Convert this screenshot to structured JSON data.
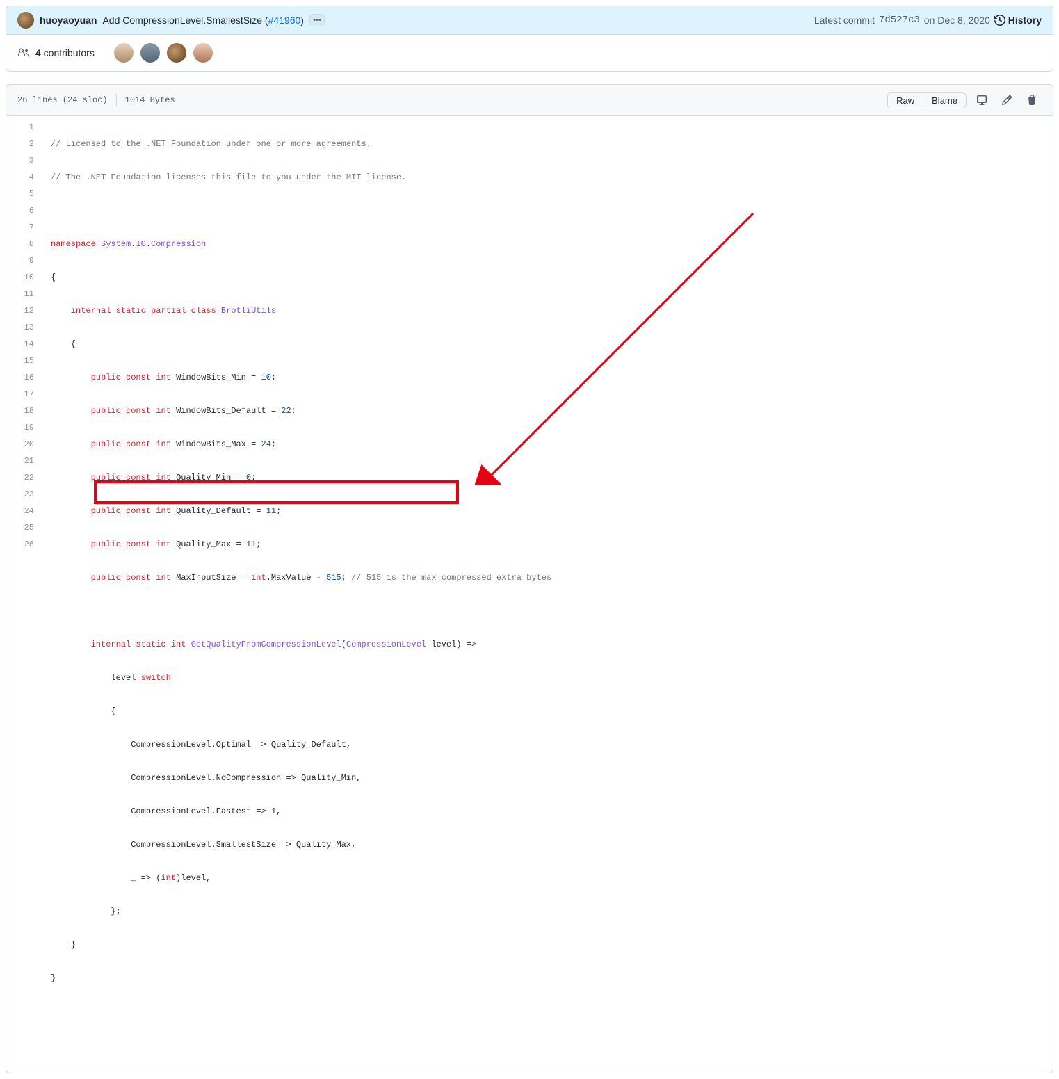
{
  "commit": {
    "author": "huoyaoyuan",
    "message_prefix": "Add CompressionLevel.SmallestSize (",
    "pr_text": "#41960",
    "message_suffix": ")",
    "latest_label": "Latest commit",
    "sha": "7d527c3",
    "date_prefix": "on ",
    "date": "Dec 8, 2020",
    "history_label": "History"
  },
  "contributors": {
    "count": "4",
    "label": " contributors"
  },
  "file": {
    "lines_sloc": "26 lines (24 sloc)",
    "bytes": "1014 Bytes",
    "raw": "Raw",
    "blame": "Blame"
  },
  "code": {
    "line_numbers": [
      "1",
      "2",
      "3",
      "4",
      "5",
      "6",
      "7",
      "8",
      "9",
      "10",
      "11",
      "12",
      "13",
      "14",
      "15",
      "16",
      "17",
      "18",
      "19",
      "20",
      "21",
      "22",
      "23",
      "24",
      "25",
      "26"
    ]
  },
  "src": {
    "l1": "// Licensed to the .NET Foundation under one or more agreements.",
    "l2": "// The .NET Foundation licenses this file to you under the MIT license.",
    "kw_namespace": "namespace",
    "ns": "System",
    "ns_io": "IO",
    "ns_comp": "Compression",
    "kw_internal": "internal",
    "kw_static": "static",
    "kw_partial": "partial",
    "kw_class": "class",
    "cls": "BrotliUtils",
    "kw_public": "public",
    "kw_const": "const",
    "ty_int": "int",
    "wb_min": "WindowBits_Min",
    "wb_min_v": "10",
    "wb_def": "WindowBits_Default",
    "wb_def_v": "22",
    "wb_max": "WindowBits_Max",
    "wb_max_v": "24",
    "q_min": "Quality_Min",
    "q_min_v": "0",
    "q_def": "Quality_Default",
    "q_def_v": "11",
    "q_max": "Quality_Max",
    "q_max_v": "11",
    "mis": "MaxInputSize",
    "mis_expr": "int",
    "mis_prop": "MaxValue",
    "mis_minus": "515",
    "mis_comment": "// 515 is the max compressed extra bytes",
    "fn": "GetQualityFromCompressionLevel",
    "param_ty": "CompressionLevel",
    "param": "level",
    "kw_switch": "switch",
    "cl": "CompressionLevel",
    "opt": "Optimal",
    "nocomp": "NoCompression",
    "fastest": "Fastest",
    "smallest": "SmallestSize",
    "one": "1",
    "cast_int": "int"
  }
}
